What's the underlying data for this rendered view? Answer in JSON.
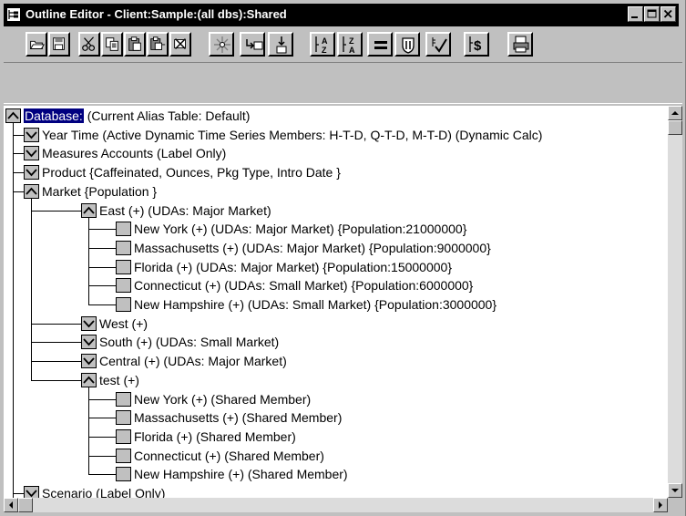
{
  "window": {
    "title": "Outline Editor - Client:Sample:(all dbs):Shared"
  },
  "toolbar": {
    "buttons": [
      {
        "name": "open-button",
        "icon": "open-folder-icon"
      },
      {
        "name": "save-button",
        "icon": "floppy-disk-icon"
      },
      {
        "name": "cut-button",
        "icon": "scissors-icon"
      },
      {
        "name": "copy-button",
        "icon": "copy-icon"
      },
      {
        "name": "paste-button",
        "icon": "paste-icon"
      },
      {
        "name": "paste-sibling-button",
        "icon": "paste-sibling-icon"
      },
      {
        "name": "delete-button",
        "icon": "delete-icon"
      },
      {
        "name": "properties-button",
        "icon": "sparkle-icon"
      },
      {
        "name": "add-sibling-button",
        "icon": "add-sibling-icon"
      },
      {
        "name": "add-child-button",
        "icon": "add-child-icon"
      },
      {
        "name": "sort-ascending-button",
        "icon": "sort-az-icon"
      },
      {
        "name": "sort-descending-button",
        "icon": "sort-za-icon"
      },
      {
        "name": "formula-button",
        "icon": "equals-icon"
      },
      {
        "name": "member-formula-button",
        "icon": "shield-icon"
      },
      {
        "name": "verify-button",
        "icon": "check-icon"
      },
      {
        "name": "currency-button",
        "icon": "dollar-icon"
      },
      {
        "name": "print-button",
        "icon": "printer-icon"
      }
    ]
  },
  "tree": {
    "nodes": [
      {
        "level": 0,
        "state": "expanded",
        "name": "Database:",
        "desc": " (Current Alias Table: Default)",
        "selected": true
      },
      {
        "level": 1,
        "state": "collapsed",
        "name": "Year",
        "desc": " Time (Active Dynamic Time Series Members: H-T-D, Q-T-D, M-T-D) (Dynamic Calc)"
      },
      {
        "level": 1,
        "state": "collapsed",
        "name": "Measures",
        "desc": " Accounts (Label Only)"
      },
      {
        "level": 1,
        "state": "collapsed",
        "name": "Product",
        "desc": " {Caffeinated, Ounces, Pkg Type, Intro Date }"
      },
      {
        "level": 1,
        "state": "expanded",
        "name": "Market",
        "desc": " {Population }"
      },
      {
        "level": 2,
        "state": "expanded",
        "name": "East",
        "desc": " (+) (UDAs: Major Market)"
      },
      {
        "level": 3,
        "state": "leaf",
        "name": "New York",
        "desc": " (+) (UDAs: Major Market) {Population:21000000}"
      },
      {
        "level": 3,
        "state": "leaf",
        "name": "Massachusetts",
        "desc": " (+) (UDAs: Major Market) {Population:9000000}"
      },
      {
        "level": 3,
        "state": "leaf",
        "name": "Florida",
        "desc": " (+) (UDAs: Major Market) {Population:15000000}"
      },
      {
        "level": 3,
        "state": "leaf",
        "name": "Connecticut",
        "desc": " (+) (UDAs: Small Market) {Population:6000000}"
      },
      {
        "level": 3,
        "state": "leaf",
        "name": "New Hampshire",
        "desc": " (+) (UDAs: Small Market) {Population:3000000}"
      },
      {
        "level": 2,
        "state": "collapsed",
        "name": "West",
        "desc": " (+)"
      },
      {
        "level": 2,
        "state": "collapsed",
        "name": "South",
        "desc": " (+) (UDAs: Small Market)"
      },
      {
        "level": 2,
        "state": "collapsed",
        "name": "Central",
        "desc": " (+) (UDAs: Major Market)"
      },
      {
        "level": 2,
        "state": "expanded",
        "name": "test",
        "desc": " (+)"
      },
      {
        "level": 3,
        "state": "leaf",
        "name": "New York",
        "desc": " (+) (Shared Member)"
      },
      {
        "level": 3,
        "state": "leaf",
        "name": "Massachusetts",
        "desc": " (+) (Shared Member)"
      },
      {
        "level": 3,
        "state": "leaf",
        "name": "Florida",
        "desc": " (+) (Shared Member)"
      },
      {
        "level": 3,
        "state": "leaf",
        "name": "Connecticut",
        "desc": " (+) (Shared Member)"
      },
      {
        "level": 3,
        "state": "leaf",
        "name": "New Hampshire",
        "desc": " (+) (Shared Member)"
      },
      {
        "level": 1,
        "state": "collapsed",
        "name": "Scenario",
        "desc": " (Label Only)"
      }
    ]
  },
  "colors": {
    "titlebar": "#000000",
    "selection": "#000080",
    "chrome": "#c0c0c0"
  }
}
